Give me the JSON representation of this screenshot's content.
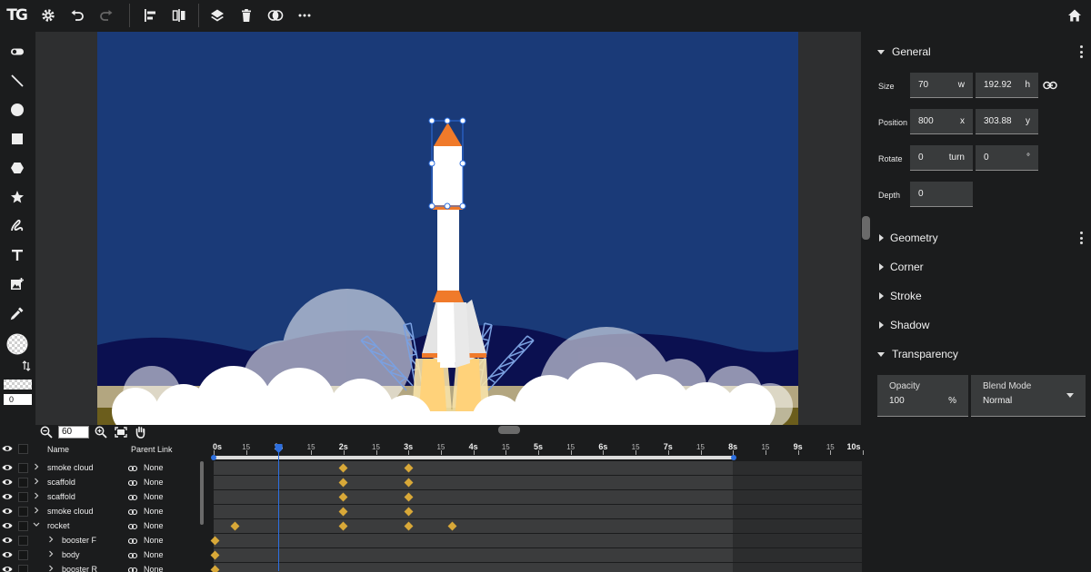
{
  "app": {
    "logo": "TG",
    "zoom": "60"
  },
  "toolbar": {
    "icons": [
      "settings-icon",
      "undo-icon",
      "redo-icon",
      "align-left-icon",
      "distribute-icon",
      "layers-icon",
      "delete-icon",
      "boolean-icon",
      "more-icon",
      "home-icon"
    ]
  },
  "tools": {
    "icons": [
      "toggle-icon",
      "line-tool-icon",
      "ellipse-tool-icon",
      "rectangle-tool-icon",
      "hexagon-tool-icon",
      "star-tool-icon",
      "freehand-tool-icon",
      "text-tool-icon",
      "image-tool-icon",
      "eyedropper-icon",
      "fill-swatch-icon",
      "swap-icon"
    ],
    "stroke_width": "0"
  },
  "properties": {
    "general": {
      "title": "General",
      "size_label": "Size",
      "width": "70",
      "width_unit": "w",
      "height": "192.92",
      "height_unit": "h",
      "position_label": "Position",
      "x": "800",
      "x_unit": "x",
      "y": "303.88",
      "y_unit": "y",
      "rotate_label": "Rotate",
      "rotate_turn": "0",
      "rotate_turn_unit": "turn",
      "rotate_deg": "0",
      "rotate_deg_unit": "°",
      "depth_label": "Depth",
      "depth": "0"
    },
    "sections": {
      "geometry": "Geometry",
      "corner": "Corner",
      "stroke": "Stroke",
      "shadow": "Shadow",
      "transparency": "Transparency"
    },
    "transparency": {
      "opacity_label": "Opacity",
      "opacity": "100",
      "opacity_unit": "%",
      "blend_label": "Blend Mode",
      "blend": "Normal"
    }
  },
  "layers": {
    "header_name": "Name",
    "header_parent": "Parent Link",
    "rows": [
      {
        "name": "smoke cloud",
        "parent": "None"
      },
      {
        "name": "scaffold",
        "parent": "None"
      },
      {
        "name": "scaffold",
        "parent": "None"
      },
      {
        "name": "smoke cloud",
        "parent": "None"
      },
      {
        "name": "rocket",
        "parent": "None"
      },
      {
        "name": "booster F",
        "parent": "None"
      },
      {
        "name": "body",
        "parent": "None"
      },
      {
        "name": "booster R",
        "parent": "None"
      }
    ]
  },
  "timeline": {
    "ticks": [
      "0s",
      "15",
      "1s",
      "15",
      "2s",
      "15",
      "3s",
      "15",
      "4s",
      "15",
      "5s",
      "15",
      "6s",
      "15",
      "7s",
      "15",
      "8s",
      "15",
      "9s",
      "15",
      "10s"
    ],
    "playhead_seconds": 1,
    "range_end_seconds": 8,
    "keyframes": [
      [
        2,
        3
      ],
      [
        2,
        3
      ],
      [
        2,
        3
      ],
      [
        2,
        3
      ],
      [
        0.33,
        2,
        3,
        3.67
      ],
      [
        0
      ],
      [
        0
      ],
      [
        0
      ]
    ]
  },
  "colors": {
    "sky": "#1a3a78",
    "rocket_orange": "#f07a2a",
    "keyframe": "#d8a838",
    "selection": "#2d6fe0"
  }
}
